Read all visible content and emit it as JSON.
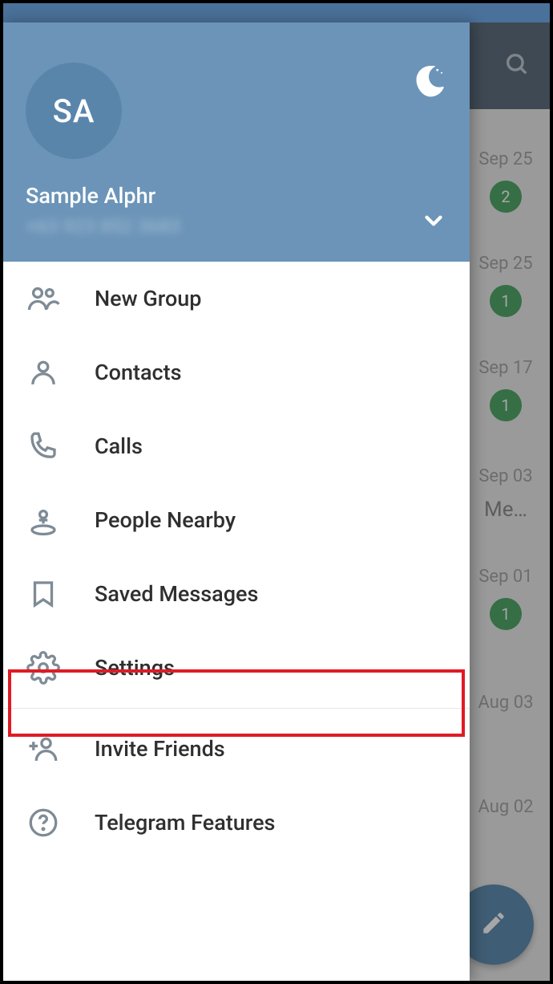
{
  "profile": {
    "initials": "SA",
    "name": "Sample Alphr",
    "phone": "+63 923 852 3683"
  },
  "menu": {
    "new_group": "New Group",
    "contacts": "Contacts",
    "calls": "Calls",
    "people_nearby": "People Nearby",
    "saved_messages": "Saved Messages",
    "settings": "Settings",
    "invite_friends": "Invite Friends",
    "telegram_features": "Telegram Features"
  },
  "chats": [
    {
      "date": "Sep 25",
      "badge": "2"
    },
    {
      "date": "Sep 25",
      "badge": "1"
    },
    {
      "date": "Sep 17",
      "badge": "1"
    },
    {
      "date": "Sep 03",
      "snippet": "Me…"
    },
    {
      "date": "Sep 01",
      "badge": "1"
    },
    {
      "date": "Aug 03"
    },
    {
      "date": "Aug 02"
    }
  ]
}
